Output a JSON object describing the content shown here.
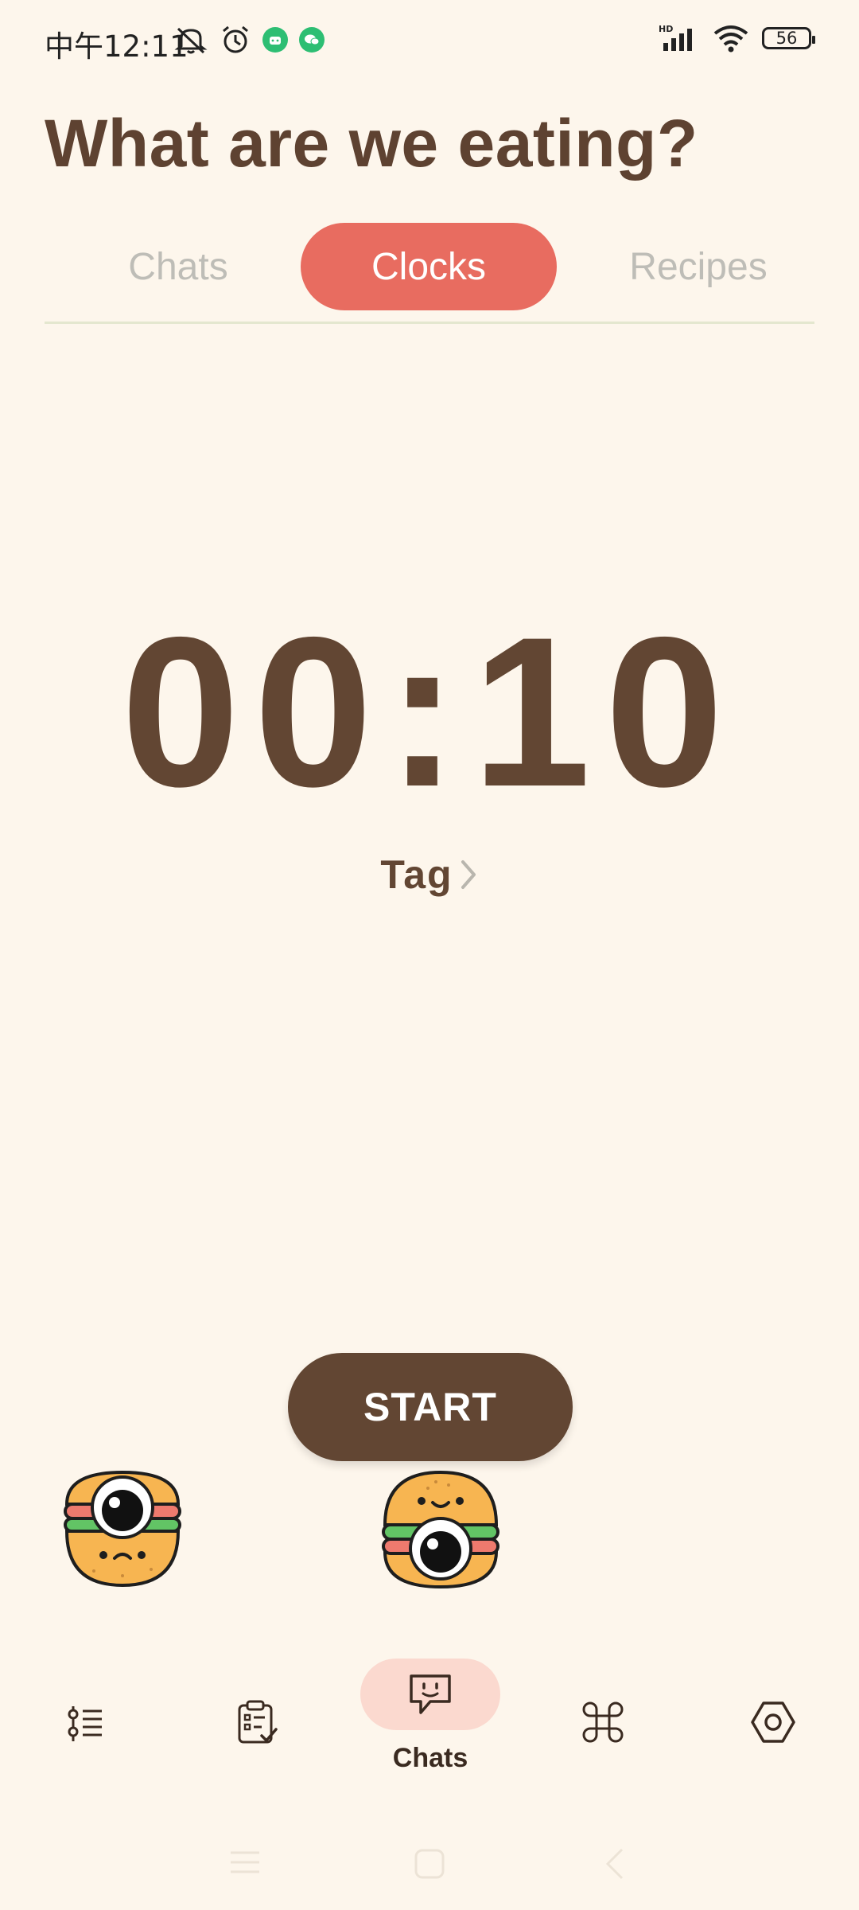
{
  "status_bar": {
    "time": "中午12:11",
    "signal_label": "HD",
    "battery": "56"
  },
  "header": {
    "title": "What are we eating?"
  },
  "tabs": [
    {
      "label": "Chats",
      "active": false
    },
    {
      "label": "Clocks",
      "active": true
    },
    {
      "label": "Recipes",
      "active": false
    }
  ],
  "timer": {
    "display": "00:10",
    "tag_label": "Tag"
  },
  "actions": {
    "start_label": "START"
  },
  "bottom_nav": {
    "items": [
      {
        "icon": "list-settings-icon",
        "label": ""
      },
      {
        "icon": "clipboard-check-icon",
        "label": ""
      },
      {
        "icon": "chat-smile-icon",
        "label": "Chats",
        "active": true
      },
      {
        "icon": "command-icon",
        "label": ""
      },
      {
        "icon": "hexagon-settings-icon",
        "label": ""
      }
    ]
  },
  "colors": {
    "background": "#FDF6EC",
    "accent": "#E86C60",
    "primary_text": "#624633",
    "inactive_tab": "#BEBDB7",
    "nav_pill": "#FBD9CF"
  }
}
